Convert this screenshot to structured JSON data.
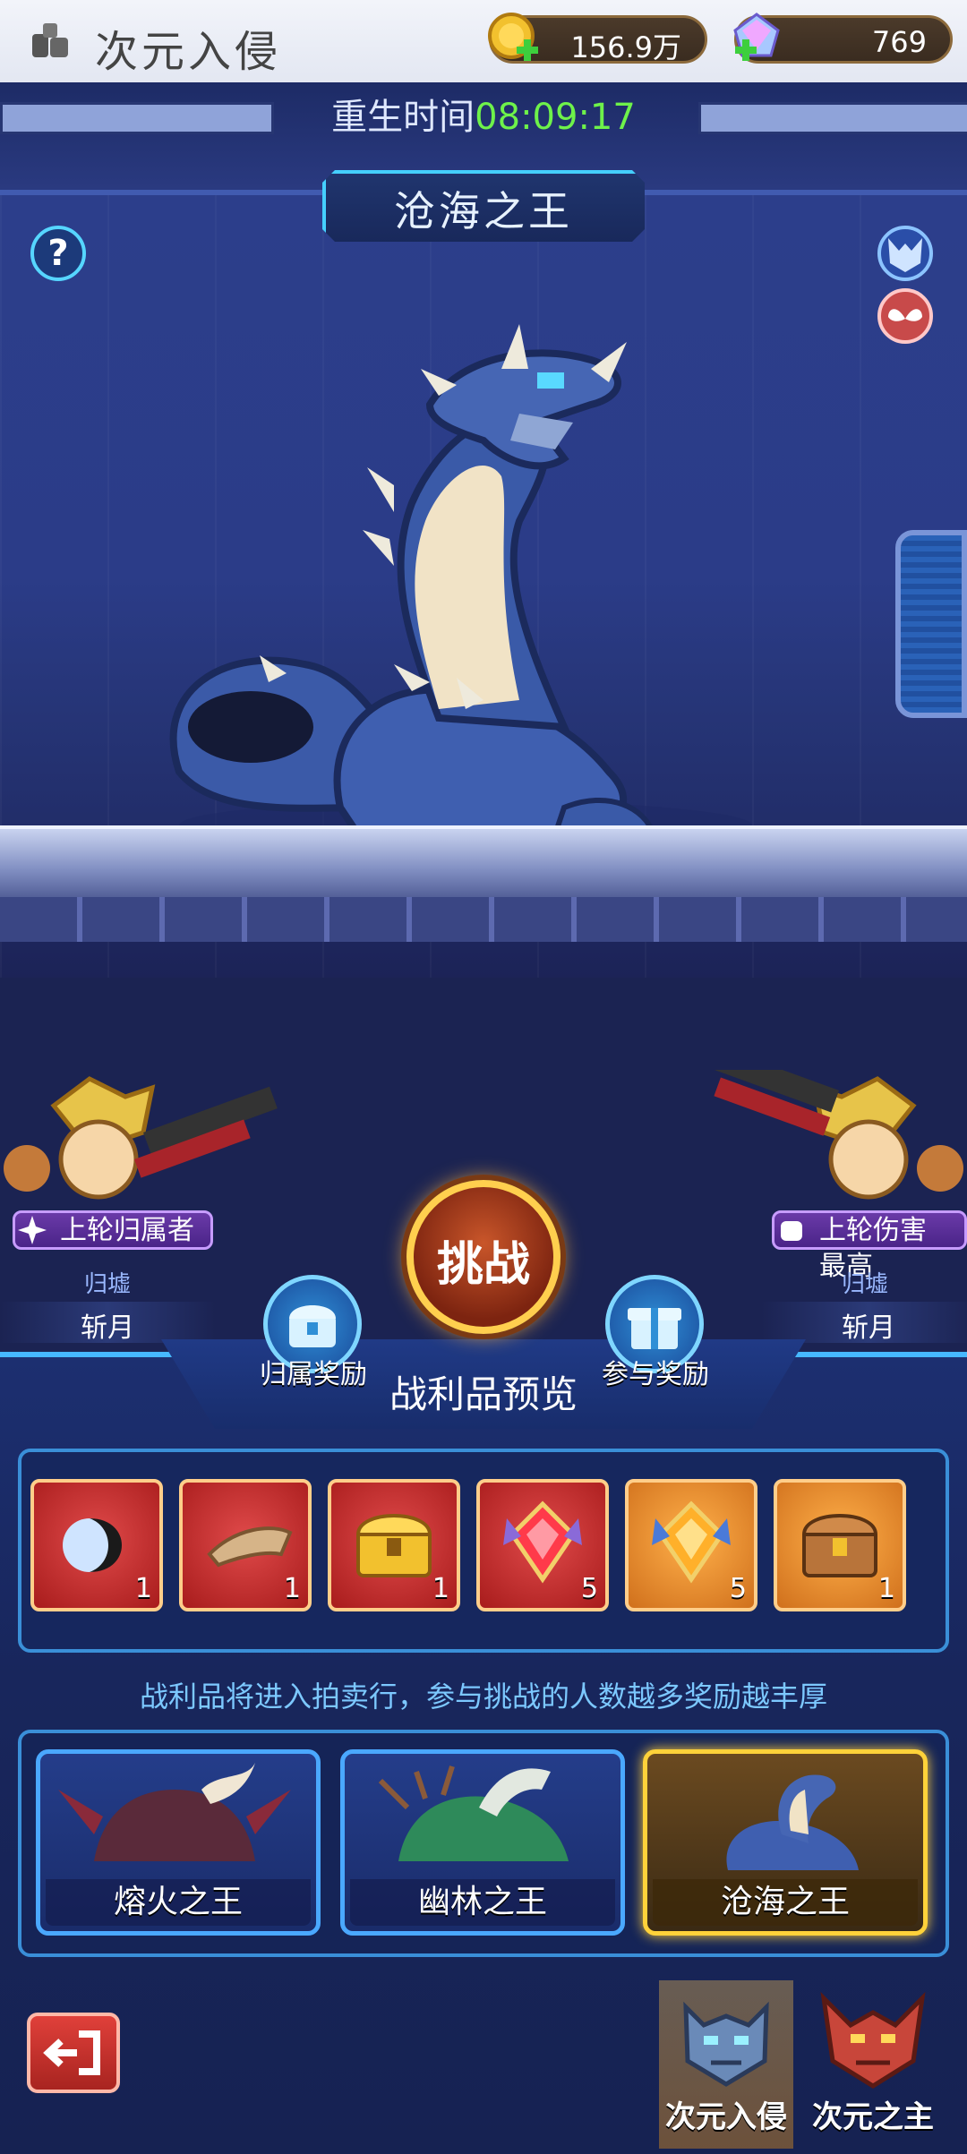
{
  "app": {
    "title": "次元入侵",
    "icon": "app-menu-icon"
  },
  "resources": {
    "coins": {
      "value": "156.9万",
      "icon": "gold-coin-plus-icon"
    },
    "gems": {
      "value": "769",
      "icon": "crystal-gem-plus-icon"
    }
  },
  "arena": {
    "respawn_label": "重生时间",
    "respawn_time": "08:09:17",
    "boss_name": "沧海之王",
    "help_icon": "question-mark-icon"
  },
  "podiums": {
    "left": {
      "badge": "上轮归属者",
      "guild": "归墟",
      "player": "斩月"
    },
    "right": {
      "badge": "上轮伤害最高",
      "guild": "归墟",
      "player": "斩月"
    }
  },
  "actions": {
    "challenge": "挑战",
    "ownership_reward": "归属奖励",
    "participation_reward": "参与奖励"
  },
  "loot": {
    "title": "战利品预览",
    "items": [
      {
        "icon": "red-black-orb-icon",
        "count": "1",
        "rarity": "red"
      },
      {
        "icon": "horn-icon",
        "count": "1",
        "rarity": "red"
      },
      {
        "icon": "golden-chest-icon",
        "count": "1",
        "rarity": "red"
      },
      {
        "icon": "red-crystal-emblem-icon",
        "count": "5",
        "rarity": "red"
      },
      {
        "icon": "orange-crystal-emblem-icon",
        "count": "5",
        "rarity": "orange"
      },
      {
        "icon": "bronze-chest-icon",
        "count": "1",
        "rarity": "orange"
      }
    ],
    "note": "战利品将进入拍卖行，参与挑战的人数越多奖励越丰厚"
  },
  "boss_tabs": [
    {
      "name": "熔火之王",
      "selected": false
    },
    {
      "name": "幽林之王",
      "selected": false
    },
    {
      "name": "沧海之王",
      "selected": true
    }
  ],
  "nav": {
    "exit_icon": "exit-arrow-icon",
    "tabs": [
      {
        "label": "次元入侵",
        "selected": true
      },
      {
        "label": "次元之主",
        "selected": false
      }
    ]
  },
  "colors": {
    "timer_green": "#6ef24a",
    "accent_cyan": "#46b8ff",
    "gold": "#ffd23a"
  }
}
